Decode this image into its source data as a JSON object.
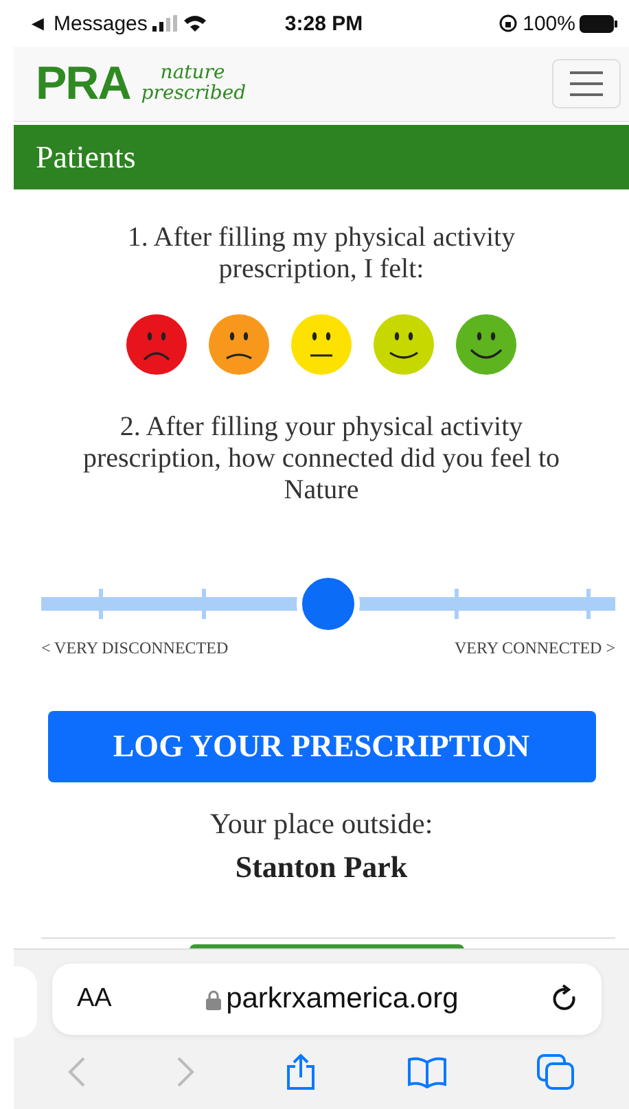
{
  "status_bar": {
    "back_app": "◄ Messages",
    "time": "3:28 PM",
    "battery": "100%"
  },
  "header": {
    "logo": "PRA",
    "tagline_1": "nature",
    "tagline_2": "prescribed"
  },
  "section_title": "Patients",
  "question_1": {
    "text": "1. After filling my physical activity prescription, I felt:",
    "faces": [
      {
        "kind": "sad",
        "color": "#e8141b",
        "selected": false
      },
      {
        "kind": "frown",
        "color": "#f7981d",
        "selected": false
      },
      {
        "kind": "neutral",
        "color": "#fde100",
        "selected": false
      },
      {
        "kind": "smile",
        "color": "#c7d700",
        "selected": false
      },
      {
        "kind": "happy",
        "color": "#5db41f",
        "selected": false
      }
    ]
  },
  "question_2": {
    "text": "2. After filling your physical activity prescription, how connected did you feel to Nature",
    "slider": {
      "level": 0.5,
      "min_label": "< VERY DISCONNECTED",
      "max_label": "VERY CONNECTED >"
    }
  },
  "log_button": "LOG YOUR PRESCRIPTION",
  "place": {
    "label": "Your place outside:",
    "name": "Stanton Park"
  },
  "browser": {
    "text_size": "AA",
    "url": "parkrxamerica.org"
  }
}
